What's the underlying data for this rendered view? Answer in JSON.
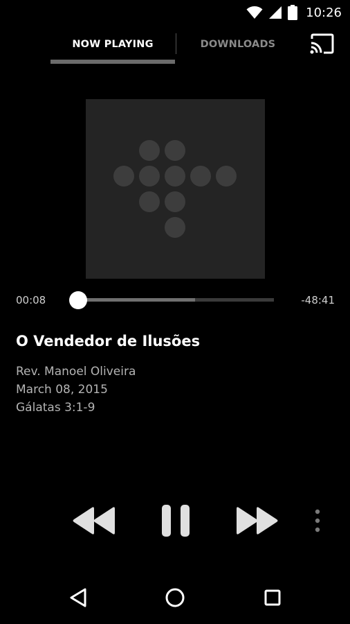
{
  "status_bar": {
    "time": "10:26",
    "icons": [
      "wifi-icon",
      "signal-icon",
      "battery-icon"
    ]
  },
  "tabs": {
    "now_playing": "NOW PLAYING",
    "downloads": "DOWNLOADS",
    "active": "now_playing"
  },
  "cast_icon": "cast-icon",
  "artwork": {
    "icon": "dots-logo-icon",
    "background": "#242424",
    "dot_color": "#3d3d3d"
  },
  "player": {
    "elapsed": "00:08",
    "remaining": "-48:41",
    "progress_fraction": 0.003,
    "buffered_fraction": 0.6
  },
  "track": {
    "title": "O Vendedor de Ilusões",
    "speaker": "Rev. Manoel Oliveira",
    "date": "March 08, 2015",
    "passage": "Gálatas 3:1-9"
  },
  "controls": {
    "rewind": "rewind-icon",
    "pause": "pause-icon",
    "fast_forward": "fast-forward-icon",
    "more": "more-vertical-icon"
  },
  "nav_bar": {
    "back": "back-icon",
    "home": "home-icon",
    "recents": "recents-icon"
  },
  "colors": {
    "background": "#000000",
    "accent": "#ffffff",
    "inactive_text": "#8a8a8a",
    "tab_indicator": "#6b6b6b"
  }
}
